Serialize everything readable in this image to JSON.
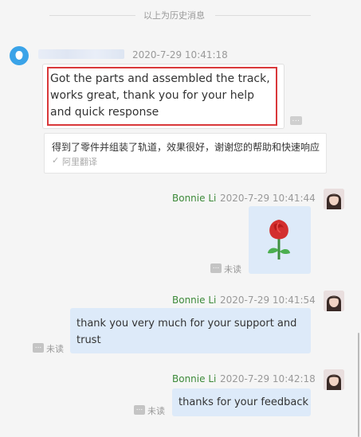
{
  "history_divider": "以上为历史消息",
  "messages": [
    {
      "sender": "",
      "time": "2020-7-29 10:41:18",
      "text": "Got the parts and assembled the track, works great, thank you for your help and quick response",
      "translation": {
        "text": "得到了零件并组装了轨道，效果很好，谢谢您的帮助和快速响应",
        "source": "阿里翻译"
      }
    },
    {
      "sender": "Bonnie Li",
      "time": "2020-7-29 10:41:44",
      "content": "rose-emoji",
      "status": "未读"
    },
    {
      "sender": "Bonnie Li",
      "time": "2020-7-29 10:41:54",
      "text": "thank you very much for your support and trust",
      "status": "未读"
    },
    {
      "sender": "Bonnie Li",
      "time": "2020-7-29 10:42:18",
      "text": "thanks for your feedback",
      "status": "未读"
    }
  ],
  "colors": {
    "background": "#f5f5f5",
    "incoming_bubble": "#ffffff",
    "outgoing_bubble": "#ddeaf9",
    "sender_name": "#3d8a3a",
    "highlight_border": "#d9383a"
  }
}
